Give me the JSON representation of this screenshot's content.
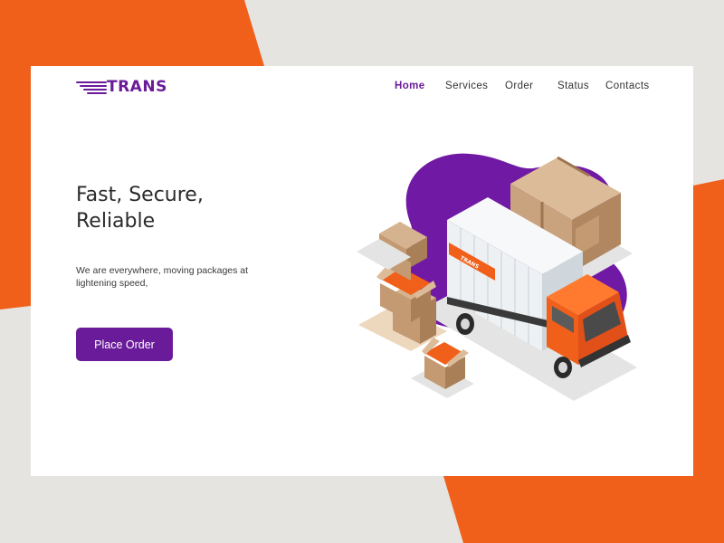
{
  "brand": {
    "name": "TRANS",
    "truck_label": "TRANS"
  },
  "nav": {
    "items": [
      "Home",
      "Services",
      "Order",
      "Status",
      "Contacts"
    ],
    "active": "Home"
  },
  "hero": {
    "title_line1": "Fast, Secure,",
    "title_line2": "Reliable",
    "subtitle": "We are everywhere, moving packages at lightening speed,",
    "cta_label": "Place Order"
  },
  "colors": {
    "accent": "#6a1b9a",
    "orange": "#f0601a",
    "background": "#e6e4e1",
    "card": "#ffffff"
  },
  "icons": {
    "logo_mark": "speed-lines-icon"
  }
}
